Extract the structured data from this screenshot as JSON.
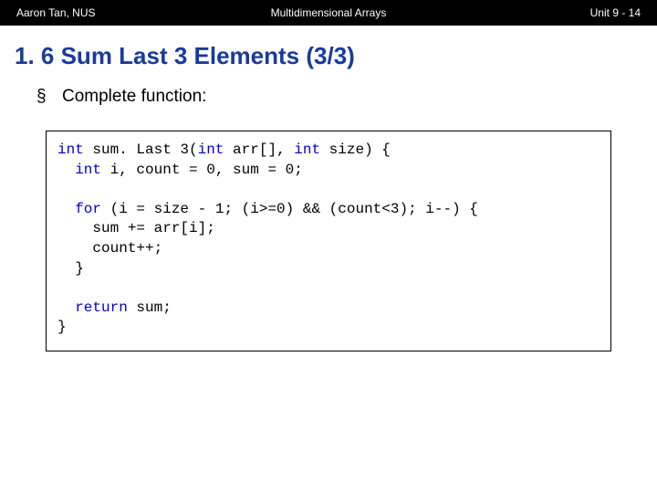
{
  "header": {
    "left": "Aaron Tan, NUS",
    "center": "Multidimensional Arrays",
    "right": "Unit 9 - 14"
  },
  "title": "1. 6 Sum Last 3 Elements (3/3)",
  "bullet": "§",
  "bullet_text": "Complete function:",
  "code": {
    "l1a": "int",
    "l1b": " sum. Last 3(",
    "l1c": "int",
    "l1d": " arr[], ",
    "l1e": "int",
    "l1f": " size) {",
    "l2a": "  ",
    "l2b": "int",
    "l2c": " i, count = 0, sum = 0;",
    "l3": "",
    "l4a": "  ",
    "l4b": "for",
    "l4c": " (i = size - 1; (i>=0) && (count<3); i--) {",
    "l5": "    sum += arr[i];",
    "l6": "    count++;",
    "l7": "  }",
    "l8": "",
    "l9a": "  ",
    "l9b": "return",
    "l9c": " sum;",
    "l10": "}"
  }
}
